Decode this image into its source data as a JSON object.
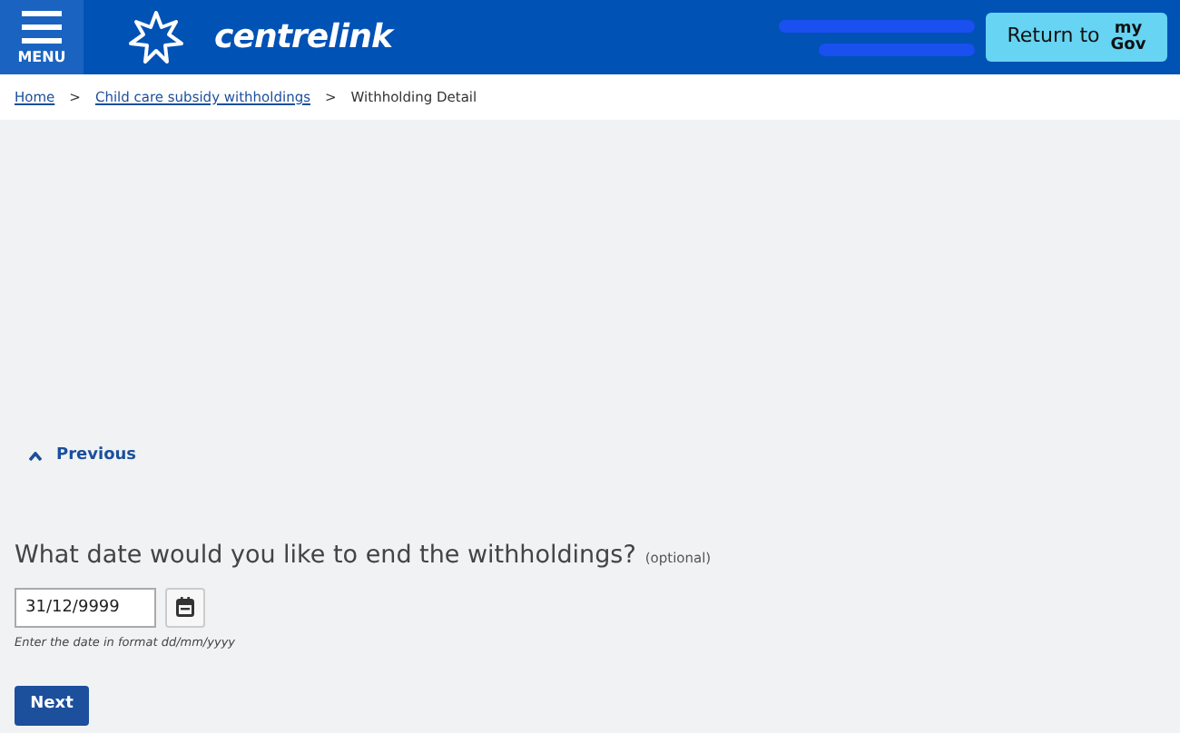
{
  "header": {
    "menu_label": "MENU",
    "brand": "centrelink",
    "return_button": {
      "label": "Return to",
      "logo_top": "my",
      "logo_bottom": "Gov"
    }
  },
  "breadcrumbs": [
    {
      "label": "Home",
      "kind": "link"
    },
    {
      "label": "Child care subsidy withholdings",
      "kind": "link"
    },
    {
      "label": "Withholding Detail",
      "kind": "current"
    }
  ],
  "breadcrumb_separator": ">",
  "previous_link": "Previous",
  "question": {
    "label": "What date would you like to end the withholdings?",
    "optional": "(optional)",
    "value": "31/12/9999",
    "hint": "Enter the date in format dd/mm/yyyy"
  },
  "next_button": "Next"
}
